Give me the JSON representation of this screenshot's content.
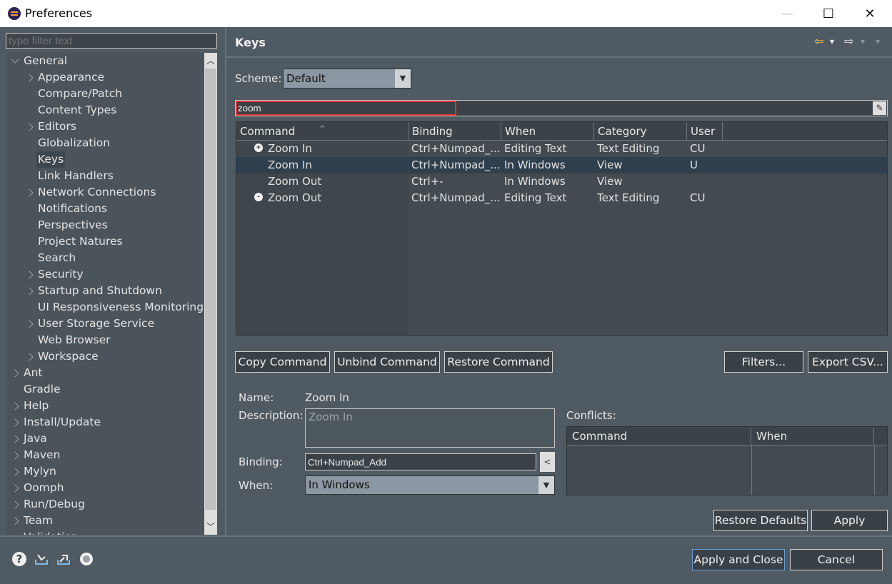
{
  "window": {
    "title": "Preferences",
    "minimize": "—",
    "maximize": "☐",
    "close": "✕"
  },
  "filter": {
    "placeholder": "type filter text"
  },
  "tree": [
    {
      "label": "General",
      "level": 0,
      "twist": "open"
    },
    {
      "label": "Appearance",
      "level": 1,
      "twist": "closed"
    },
    {
      "label": "Compare/Patch",
      "level": 1,
      "twist": ""
    },
    {
      "label": "Content Types",
      "level": 1,
      "twist": ""
    },
    {
      "label": "Editors",
      "level": 1,
      "twist": "closed"
    },
    {
      "label": "Globalization",
      "level": 1,
      "twist": ""
    },
    {
      "label": "Keys",
      "level": 1,
      "twist": "",
      "selected": true
    },
    {
      "label": "Link Handlers",
      "level": 1,
      "twist": ""
    },
    {
      "label": "Network Connections",
      "level": 1,
      "twist": "closed"
    },
    {
      "label": "Notifications",
      "level": 1,
      "twist": ""
    },
    {
      "label": "Perspectives",
      "level": 1,
      "twist": ""
    },
    {
      "label": "Project Natures",
      "level": 1,
      "twist": ""
    },
    {
      "label": "Search",
      "level": 1,
      "twist": ""
    },
    {
      "label": "Security",
      "level": 1,
      "twist": "closed"
    },
    {
      "label": "Startup and Shutdown",
      "level": 1,
      "twist": "closed"
    },
    {
      "label": "UI Responsiveness Monitoring",
      "level": 1,
      "twist": ""
    },
    {
      "label": "User Storage Service",
      "level": 1,
      "twist": "closed"
    },
    {
      "label": "Web Browser",
      "level": 1,
      "twist": ""
    },
    {
      "label": "Workspace",
      "level": 1,
      "twist": "closed"
    },
    {
      "label": "Ant",
      "level": 0,
      "twist": "closed"
    },
    {
      "label": "Gradle",
      "level": 0,
      "twist": ""
    },
    {
      "label": "Help",
      "level": 0,
      "twist": "closed"
    },
    {
      "label": "Install/Update",
      "level": 0,
      "twist": "closed"
    },
    {
      "label": "Java",
      "level": 0,
      "twist": "closed"
    },
    {
      "label": "Maven",
      "level": 0,
      "twist": "closed"
    },
    {
      "label": "Mylyn",
      "level": 0,
      "twist": "closed"
    },
    {
      "label": "Oomph",
      "level": 0,
      "twist": "closed"
    },
    {
      "label": "Run/Debug",
      "level": 0,
      "twist": "closed"
    },
    {
      "label": "Team",
      "level": 0,
      "twist": "closed"
    },
    {
      "label": "Validation",
      "level": 0,
      "twist": ""
    }
  ],
  "page": {
    "title": "Keys",
    "nav": {
      "back": "⇦",
      "dropdown": "▾",
      "forward": "⇨",
      "menu": "▾"
    },
    "scheme_label": "Scheme:",
    "scheme_value": "Default",
    "search_value": "zoom",
    "columns": [
      "Command",
      "Binding",
      "When",
      "Category",
      "User"
    ],
    "rows": [
      {
        "command": "Zoom In",
        "icon": "+",
        "binding": "Ctrl+Numpad_...",
        "when": "Editing Text",
        "category": "Text Editing",
        "user": "CU",
        "selected": false
      },
      {
        "command": "Zoom In",
        "icon": "",
        "binding": "Ctrl+Numpad_...",
        "when": "In Windows",
        "category": "View",
        "user": " U",
        "selected": true
      },
      {
        "command": "Zoom Out",
        "icon": "",
        "binding": "Ctrl+-",
        "when": "In Windows",
        "category": "View",
        "user": "",
        "selected": false
      },
      {
        "command": "Zoom Out",
        "icon": "-",
        "binding": "Ctrl+Numpad_...",
        "when": "Editing Text",
        "category": "Text Editing",
        "user": "CU",
        "selected": false
      }
    ],
    "buttons": {
      "copy": "Copy Command",
      "unbind": "Unbind Command",
      "restore": "Restore Command",
      "filters": "Filters...",
      "export": "Export CSV..."
    },
    "details": {
      "name_label": "Name:",
      "name_value": "Zoom In",
      "description_label": "Description:",
      "description_value": "Zoom In",
      "binding_label": "Binding:",
      "binding_value": "Ctrl+Numpad_Add",
      "when_label": "When:",
      "when_value": "In Windows",
      "binding_button": "<"
    },
    "conflicts": {
      "label": "Conflicts:",
      "columns": [
        "Command",
        "When"
      ]
    },
    "restore_defaults": "Restore Defaults",
    "apply": "Apply"
  },
  "footer": {
    "help_icon": "?",
    "apply_and_close": "Apply and Close",
    "cancel": "Cancel"
  },
  "colors": {
    "background": "#505a62",
    "selection_row": "#2f3f4e",
    "highlight_border": "#e03333"
  }
}
